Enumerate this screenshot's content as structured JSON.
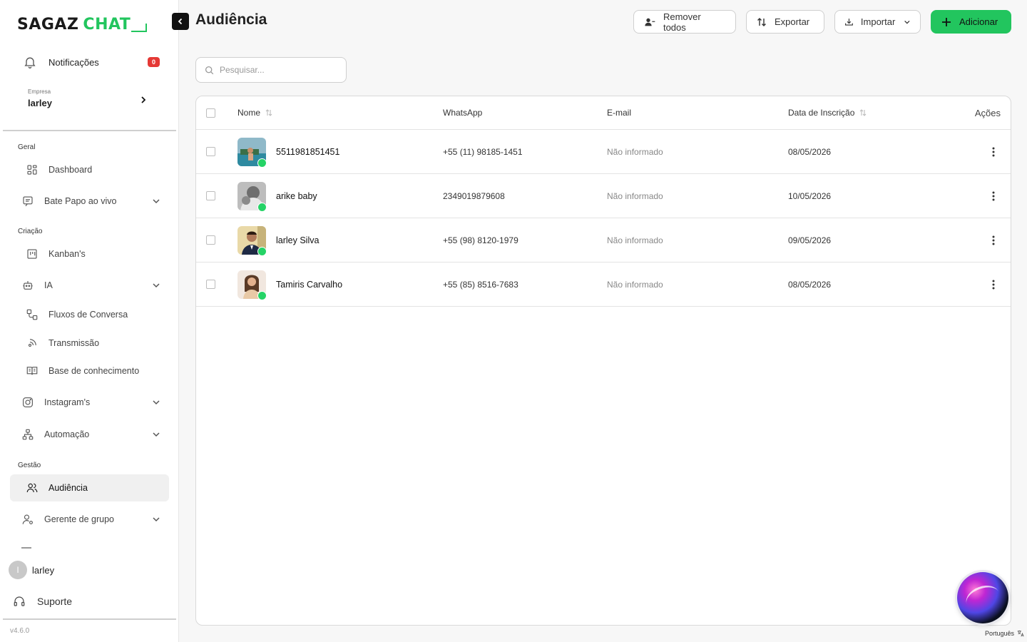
{
  "app": {
    "logo_main": "SAGAZ",
    "logo_accent": "CHAT",
    "version": "v4.6.0",
    "language": "Português"
  },
  "sidebar": {
    "notifications": {
      "label": "Notificações",
      "count": "0"
    },
    "company": {
      "small_label": "Empresa",
      "name": "larley"
    },
    "sections": {
      "geral": "Geral",
      "criacao": "Criação",
      "gestao": "Gestão"
    },
    "items": [
      {
        "label": "Dashboard",
        "icon": "dashboard-icon"
      },
      {
        "label": "Bate Papo ao vivo",
        "icon": "chat-icon"
      },
      {
        "label": "Kanban's",
        "icon": "kanban-icon"
      },
      {
        "label": "IA",
        "icon": "robot-icon"
      },
      {
        "label": "Fluxos de Conversa",
        "icon": "flow-icon"
      },
      {
        "label": "Transmissão",
        "icon": "broadcast-icon"
      },
      {
        "label": "Base de conhecimento",
        "icon": "book-icon"
      },
      {
        "label": "Instagram's",
        "icon": "instagram-icon"
      },
      {
        "label": "Automação",
        "icon": "automation-icon"
      },
      {
        "label": "Audiência",
        "icon": "users-icon"
      },
      {
        "label": "Gerente de grupo",
        "icon": "group-manager-icon"
      }
    ],
    "user": {
      "initial": "I",
      "name": "larley"
    },
    "support": "Suporte"
  },
  "header": {
    "title": "Audiência",
    "buttons": {
      "remove_all": "Remover todos",
      "export": "Exportar",
      "import": "Importar",
      "add": "Adicionar"
    }
  },
  "search": {
    "placeholder": "Pesquisar..."
  },
  "table": {
    "columns": {
      "name": "Nome",
      "whatsapp": "WhatsApp",
      "email": "E-mail",
      "date": "Data de Inscrição",
      "actions": "Ações"
    },
    "rows": [
      {
        "name": "5511981851451",
        "whatsapp": "+55 (11) 98185-1451",
        "email": "Não informado",
        "date": "08/05/2026"
      },
      {
        "name": "arike baby",
        "whatsapp": "2349019879608",
        "email": "Não informado",
        "date": "10/05/2026"
      },
      {
        "name": "larley Silva",
        "whatsapp": "+55 (98) 8120-1979",
        "email": "Não informado",
        "date": "09/05/2026"
      },
      {
        "name": "Tamiris Carvalho",
        "whatsapp": "+55 (85) 8516-7683",
        "email": "Não informado",
        "date": "08/05/2026"
      }
    ]
  },
  "colors": {
    "accent": "#22c55e",
    "badge": "#e53935",
    "whatsapp": "#25d366"
  }
}
